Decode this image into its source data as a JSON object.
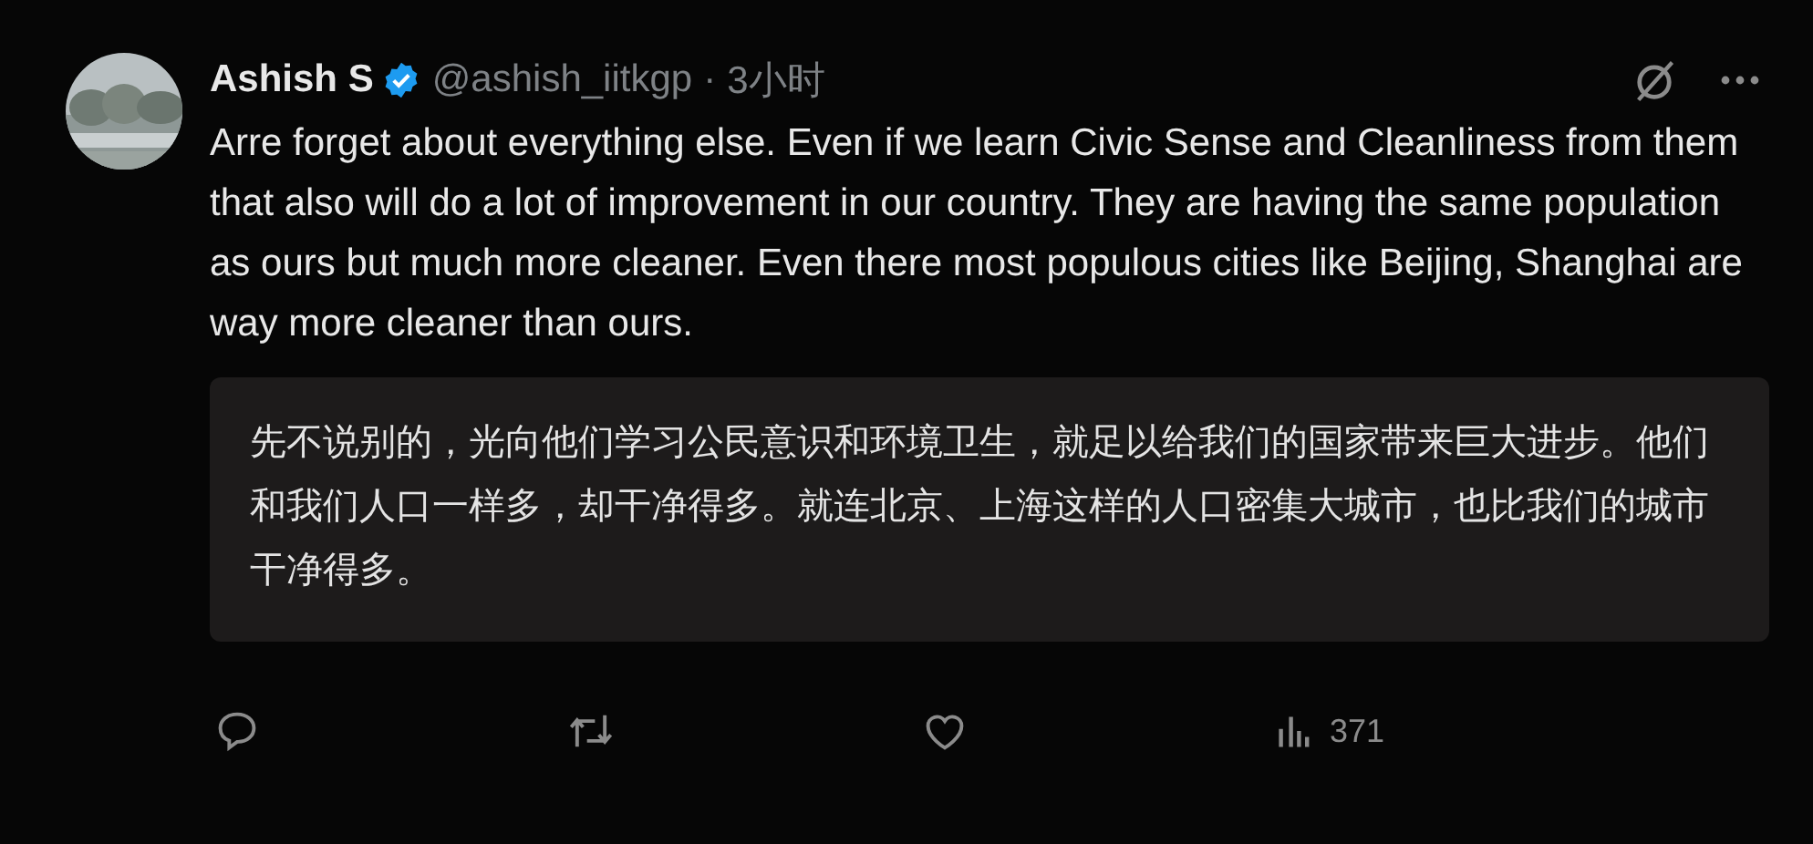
{
  "tweet": {
    "author_name": "Ashish S",
    "verified": true,
    "handle": "@ashish_iitkgp",
    "separator": "·",
    "time": "3小时",
    "text": "Arre forget about everything else. Even if we learn Civic Sense and Cleanliness from them that also will do a lot of improvement in our country. They are having the same population as ours but much more cleaner. Even there most populous cities like Beijing, Shanghai are way more cleaner than ours.",
    "translation": "先不说别的，光向他们学习公民意识和环境卫生，就足以给我们的国家带来巨大进步。他们和我们人口一样多，却干净得多。就连北京、上海这样的人口密集大城市，也比我们的城市干净得多。",
    "actions": [
      {
        "kind": "reply"
      },
      {
        "kind": "retweet"
      },
      {
        "kind": "like"
      },
      {
        "kind": "views",
        "count": "371"
      }
    ]
  }
}
